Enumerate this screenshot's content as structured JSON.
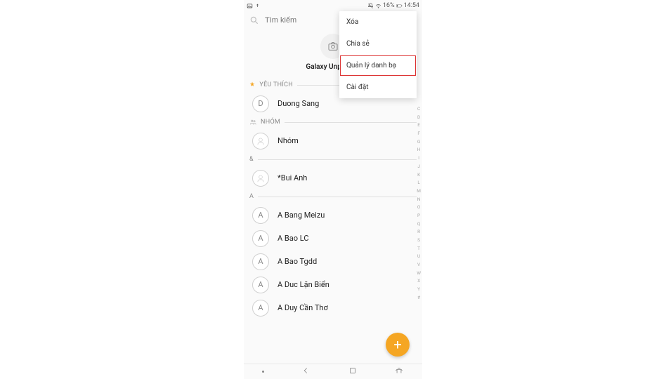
{
  "status": {
    "battery_text": "16%",
    "time": "14:54"
  },
  "search": {
    "placeholder": "Tìm kiếm"
  },
  "profile": {
    "name": "Galaxy Unpacked"
  },
  "sections": {
    "favorites": "YÊU THÍCH",
    "groups": "NHÓM",
    "amp": "&",
    "a": "A"
  },
  "contacts": {
    "fav": {
      "initial": "D",
      "name": "Duong Sang"
    },
    "group": {
      "name": "Nhóm"
    },
    "amp": {
      "name": "*Bui Anh"
    },
    "a": [
      {
        "initial": "A",
        "name": "A Bang Meizu"
      },
      {
        "initial": "A",
        "name": "A Bao LC"
      },
      {
        "initial": "A",
        "name": "A Bao Tgdd"
      },
      {
        "initial": "A",
        "name": "A Duc Lặn Biển"
      },
      {
        "initial": "A",
        "name": "A Duy Cần Thơ"
      }
    ]
  },
  "menu": {
    "items": [
      "Xóa",
      "Chia sẻ",
      "Quản lý danh bạ",
      "Cài đặt"
    ]
  },
  "index_rail": [
    "C",
    "D",
    "E",
    "F",
    "G",
    "H",
    "I",
    "J",
    "K",
    "L",
    "M",
    "N",
    "O",
    "P",
    "Q",
    "R",
    "S",
    "T",
    "U",
    "V",
    "W",
    "X",
    "Y",
    "#"
  ]
}
